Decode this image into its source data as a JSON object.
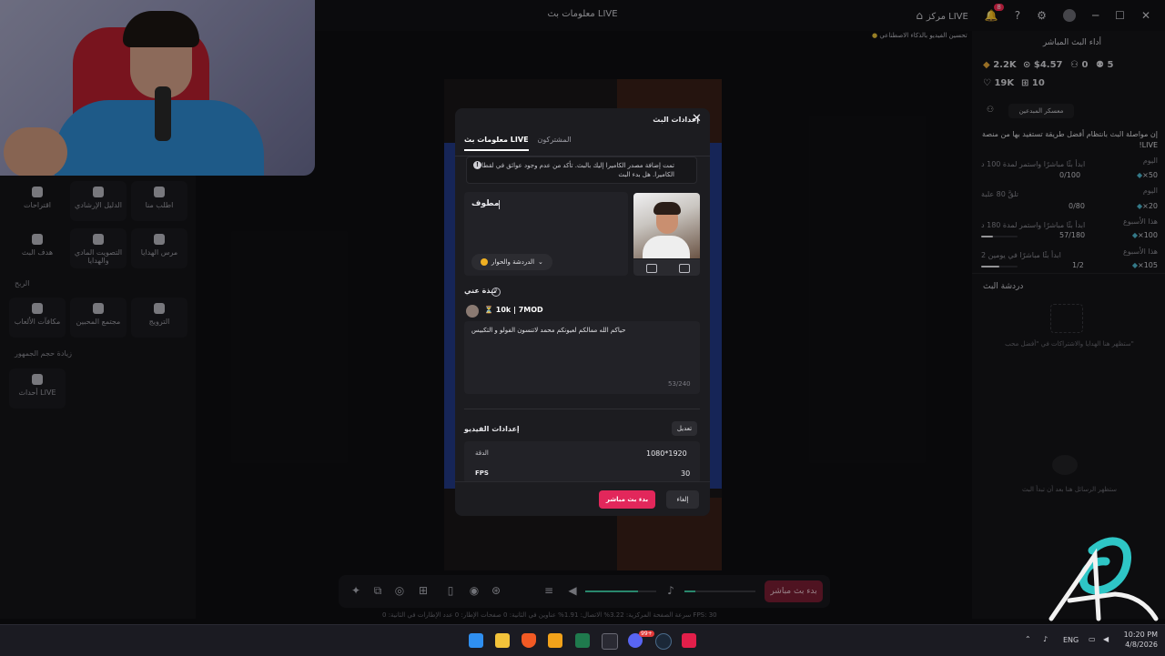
{
  "window": {
    "title": "معلومات بث LIVE",
    "live_center": "مركز LIVE",
    "notification_count": "8"
  },
  "ai_hint": "تحسين الفيديو بالذكاء الاصطناعي",
  "left_tools": [
    {
      "label": "اطلب منا"
    },
    {
      "label": "الدليل الإرشادي"
    },
    {
      "label": "اقتراحات"
    },
    {
      "label": "مرس الهدايا"
    },
    {
      "label": "التصويت المادي والهدايا"
    },
    {
      "label": "هدف البث"
    },
    {
      "label": "الترويج"
    },
    {
      "label": "مجتمع المحبين"
    },
    {
      "label": "مكافآت الألعاب"
    },
    {
      "label": "أحداث LIVE"
    }
  ],
  "left_sections": {
    "profit": "الربح",
    "audience": "زيادة حجم الجمهور"
  },
  "right_panel": {
    "title": "أداء البث المباشر",
    "stats": [
      "2.2K",
      "$4.57",
      "0",
      "5"
    ],
    "stats2": [
      "19K",
      "10"
    ],
    "creator_camp": "معسكر المبدعين",
    "cta": "إن مواصلة البث بانتظام أفضل طريقة تستفيد بها من منصة LIVE!",
    "missions": [
      {
        "tag": "اليوم",
        "text": "ابدأ بثًا مباشرًا واستمر لمدة 100 د",
        "progress": "0/100",
        "reward": "×50",
        "fill": 0
      },
      {
        "tag": "اليوم",
        "text": "تلقَّ 80 علبة",
        "progress": "0/80",
        "reward": "×20",
        "fill": 0
      },
      {
        "tag": "هذا الأسبوع",
        "text": "ابدأ بثًا مباشرًا واستمر لمدة 180 د",
        "progress": "57/180",
        "reward": "×100",
        "fill": 0.32
      },
      {
        "tag": "هذا الأسبوع",
        "text": "ابدأ بثًا مباشرًا في يومين 2",
        "progress": "1/2",
        "reward": "×105",
        "fill": 0.5
      }
    ],
    "chat_title": "دردشة البث",
    "chat_gifts_hint": "ستظهر هنا الهدايا والاشتراكات في \"أفضل محب\"",
    "chat_empty": "ستظهر الرسائل هنا بعد أن تبدأ البث"
  },
  "modal": {
    "title": "إعدادات البث",
    "tabs": [
      "معلومات بث LIVE",
      "المشتركون"
    ],
    "notice": "تمت إضافة مصدر الكاميرا إليك بالبث. تأكد من عدم وجود عوائق في لقطات الكاميرا. هل بدء البث",
    "stream_title": "مطوف",
    "category": "الدردشة والحوار",
    "about_label": "نبذة عني",
    "username": "⏳ 10k | 7MOD",
    "bio": "حياكم الله ممالكم لعيونكم محمد لاتنسون الفولو و التكبيس",
    "bio_count": "53/240",
    "video_settings_label": "إعدادات الفيديو",
    "edit_label": "تعديل",
    "resolution_label": "الدقة",
    "resolution_value": "1080*1920",
    "fps_label": "FPS",
    "fps_value": "30",
    "cancel_label": "إلغاء",
    "start_label": "بدء بث مباشر"
  },
  "controls": {
    "go_live": "بدء بث مباشر"
  },
  "status_bar": "سرعة الصفحة المركزية: 3.22%   الاتصال: 1.91%   عناوين في الثانية: 0   صفحات الإطار: 0   عدد الإطارات في الثانية: 0   FPS: 30",
  "taskbar": {
    "lang": "ENG",
    "time": "10:20 PM",
    "date": "4/8/2026",
    "discord_badge": "99+"
  },
  "colors": {
    "accent": "#e2275b",
    "audio": "#3fd0a8",
    "bg": "#0f0f12"
  }
}
